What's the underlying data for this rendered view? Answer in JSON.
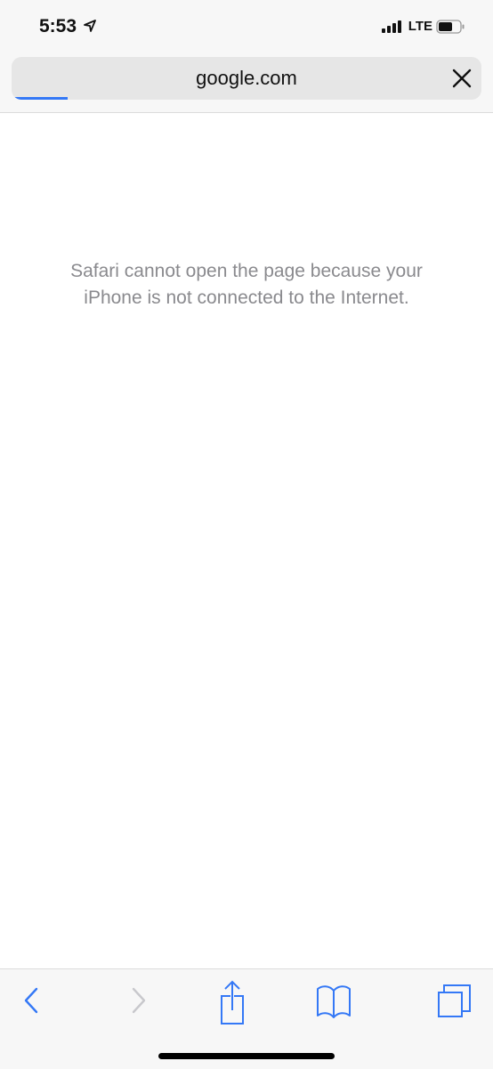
{
  "status_bar": {
    "time": "5:53",
    "network": "LTE",
    "icons": [
      "location-arrow-icon",
      "signal-bars-icon",
      "battery-icon"
    ]
  },
  "address_bar": {
    "url": "google.com",
    "load_progress": 0.12,
    "accent": "#3478f6"
  },
  "page": {
    "error_message": "Safari cannot open the page because your iPhone is not connected to the Internet."
  },
  "toolbar": {
    "items": [
      "back",
      "forward",
      "share",
      "bookmarks",
      "tabs"
    ],
    "tint": "#3478f6"
  }
}
